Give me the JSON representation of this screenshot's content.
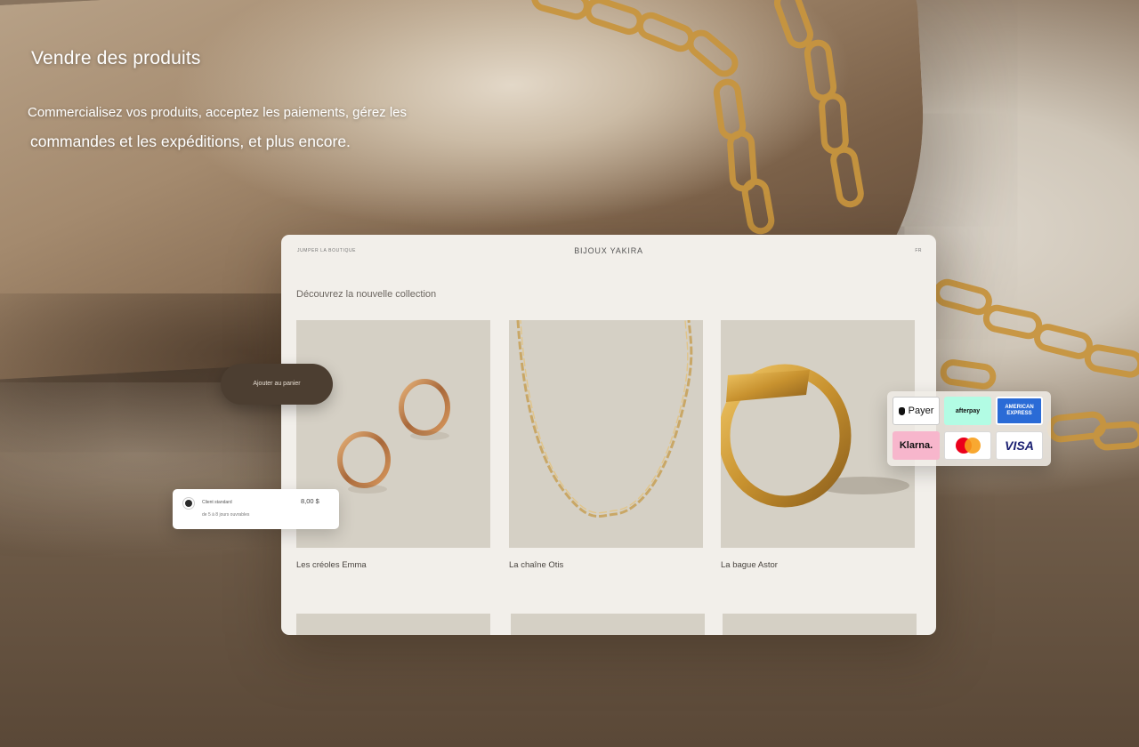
{
  "hero": {
    "title": "Vendre des produits",
    "description_line1": "Commercialisez vos produits, acceptez les paiements, gérez les",
    "description_line2": "commandes et les expéditions, et plus encore."
  },
  "storefront": {
    "nav_left": "JUMPER LA BOUTIQUE",
    "brand": "BIJOUX YAKIRA",
    "language": "FR",
    "heading": "Découvrez la nouvelle collection",
    "products": [
      {
        "name": "Les créoles Emma",
        "icon": "hoop-earrings"
      },
      {
        "name": "La chaîne Otis",
        "icon": "chain-necklace"
      },
      {
        "name": "La bague Astor",
        "icon": "signet-ring"
      }
    ]
  },
  "cart": {
    "add_label": "Ajouter au panier"
  },
  "shipping": {
    "label": "Client standard",
    "sub": "de 5 à 8 jours ouvrables",
    "price": "8,00 $"
  },
  "payments": {
    "apple_pay": "Payer",
    "afterpay": "afterpay",
    "amex_line1": "AMERICAN",
    "amex_line2": "EXPRESS",
    "klarna": "Klarna.",
    "visa": "VISA"
  },
  "colors": {
    "store_bg": "#f2efea",
    "product_tile": "#d5d0c5",
    "add_cart_bg": "#4c3e31",
    "gold": "#c8953f"
  }
}
